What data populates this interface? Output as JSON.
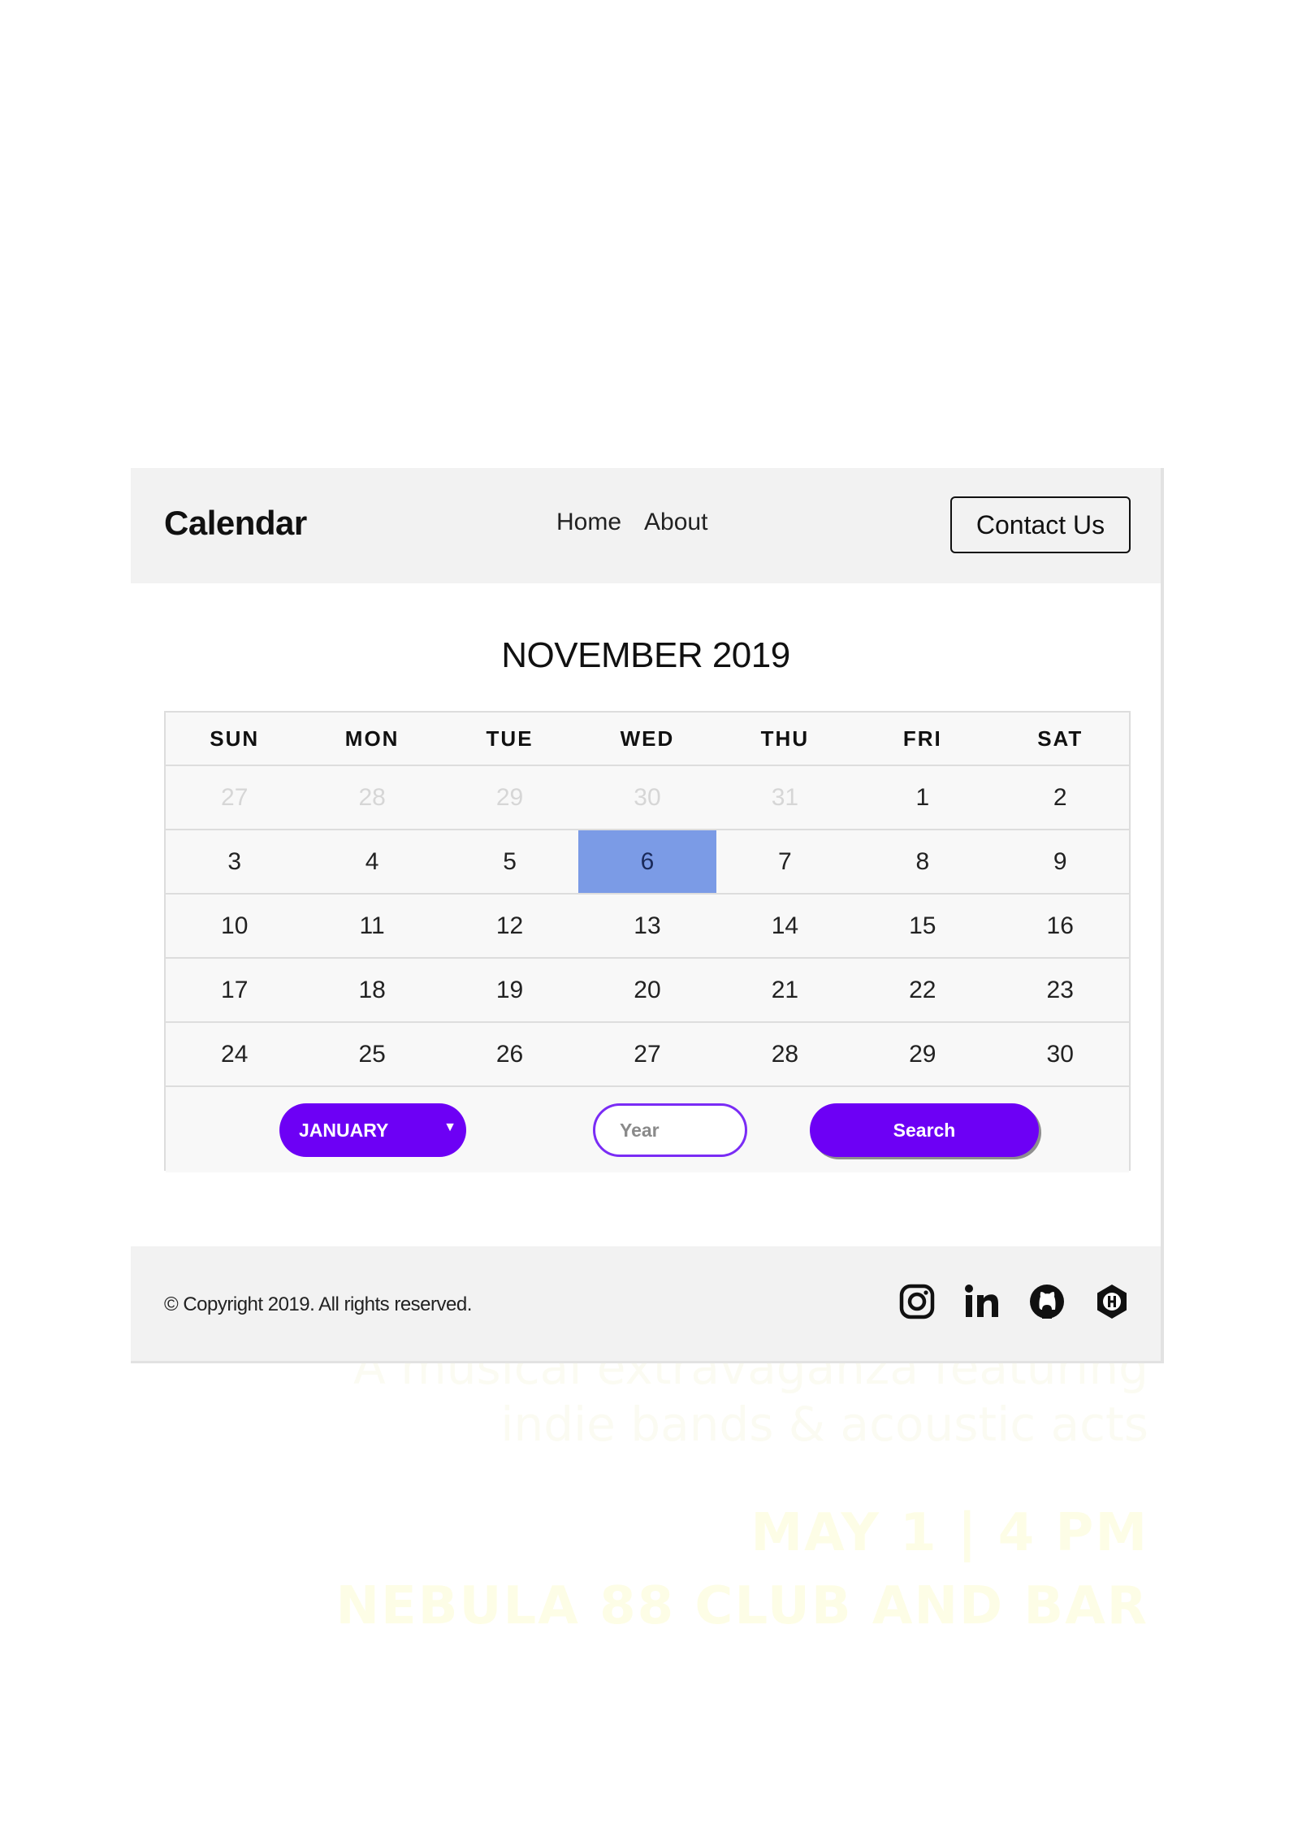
{
  "app": {
    "brand": "Calendar",
    "nav": [
      "Home",
      "About"
    ],
    "contact_label": "Contact Us"
  },
  "calendar": {
    "title": "NOVEMBER 2019",
    "weekdays": [
      "SUN",
      "MON",
      "TUE",
      "WED",
      "THU",
      "FRI",
      "SAT"
    ],
    "weeks": [
      [
        {
          "d": "27",
          "muted": true
        },
        {
          "d": "28",
          "muted": true
        },
        {
          "d": "29",
          "muted": true
        },
        {
          "d": "30",
          "muted": true
        },
        {
          "d": "31",
          "muted": true
        },
        {
          "d": "1"
        },
        {
          "d": "2"
        }
      ],
      [
        {
          "d": "3"
        },
        {
          "d": "4"
        },
        {
          "d": "5"
        },
        {
          "d": "6",
          "today": true
        },
        {
          "d": "7"
        },
        {
          "d": "8"
        },
        {
          "d": "9"
        }
      ],
      [
        {
          "d": "10"
        },
        {
          "d": "11"
        },
        {
          "d": "12"
        },
        {
          "d": "13"
        },
        {
          "d": "14"
        },
        {
          "d": "15"
        },
        {
          "d": "16"
        }
      ],
      [
        {
          "d": "17"
        },
        {
          "d": "18"
        },
        {
          "d": "19"
        },
        {
          "d": "20"
        },
        {
          "d": "21"
        },
        {
          "d": "22"
        },
        {
          "d": "23"
        }
      ],
      [
        {
          "d": "24"
        },
        {
          "d": "25"
        },
        {
          "d": "26"
        },
        {
          "d": "27"
        },
        {
          "d": "28"
        },
        {
          "d": "29"
        },
        {
          "d": "30"
        }
      ]
    ],
    "today_color": "#7b9be6"
  },
  "controls": {
    "month_selected": "JANUARY",
    "year_placeholder": "Year",
    "search_label": "Search",
    "accent": "#6d00f5"
  },
  "footer": {
    "copyright": "© Copyright 2019. All rights reserved.",
    "social_icons": [
      "instagram-icon",
      "linkedin-icon",
      "github-icon",
      "hashnode-icon"
    ]
  },
  "background_text": {
    "tagline_line1": "A musical extravaganza featuring",
    "tagline_line2": "indie bands & acoustic acts",
    "date": "MAY 1 | 4 PM",
    "venue": "NEBULA 88 CLUB AND BAR"
  }
}
